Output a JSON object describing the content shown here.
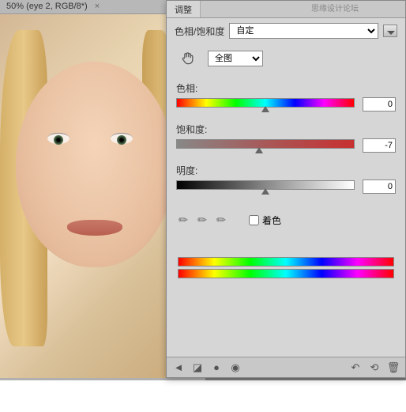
{
  "document": {
    "title": "50% (eye 2, RGB/8*)"
  },
  "watermark": "思缘设计论坛",
  "panel": {
    "tab_label": "调整",
    "preset_label": "色相/饱和度",
    "preset_value": "自定",
    "channel_value": "全图",
    "hue": {
      "label": "色相:",
      "value": "0",
      "pos": 50
    },
    "saturation": {
      "label": "饱和度:",
      "value": "-7",
      "pos": 46.5
    },
    "lightness": {
      "label": "明度:",
      "value": "0",
      "pos": 50
    },
    "colorize_label": "着色"
  }
}
